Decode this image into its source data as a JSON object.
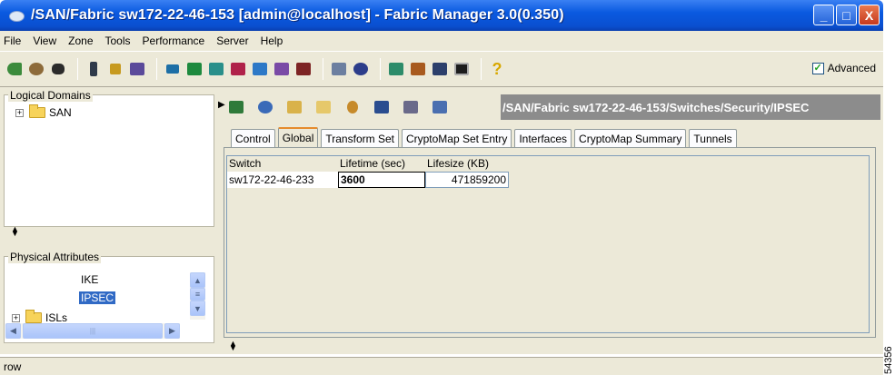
{
  "window": {
    "title": "/SAN/Fabric sw172-22-46-153 [admin@localhost] - Fabric Manager 3.0(0.350)",
    "buttons": [
      "_",
      "□",
      "X"
    ]
  },
  "menu": [
    "File",
    "View",
    "Zone",
    "Tools",
    "Performance",
    "Server",
    "Help"
  ],
  "toolbar": {
    "advanced_label": "Advanced",
    "advanced_checked": true
  },
  "logical_domains": {
    "title": "Logical Domains",
    "items": [
      {
        "label": "SAN",
        "expand": "+"
      }
    ]
  },
  "physical_attributes": {
    "title": "Physical Attributes",
    "items": [
      {
        "label": "IKE",
        "selected": false
      },
      {
        "label": "IPSEC",
        "selected": true
      }
    ],
    "folder_item": "ISLs"
  },
  "path": "/SAN/Fabric sw172-22-46-153/Switches/Security/IPSEC",
  "tabs": [
    "Control",
    "Global",
    "Transform Set",
    "CryptoMap Set Entry",
    "Interfaces",
    "CryptoMap Summary",
    "Tunnels"
  ],
  "active_tab": "Global",
  "table": {
    "columns": [
      "Switch",
      "Lifetime (sec)",
      "Lifesize (KB)"
    ],
    "rows": [
      [
        "sw172-22-46-233",
        "3600",
        "471859200"
      ]
    ]
  },
  "status_text": "row",
  "side_number": "54356"
}
